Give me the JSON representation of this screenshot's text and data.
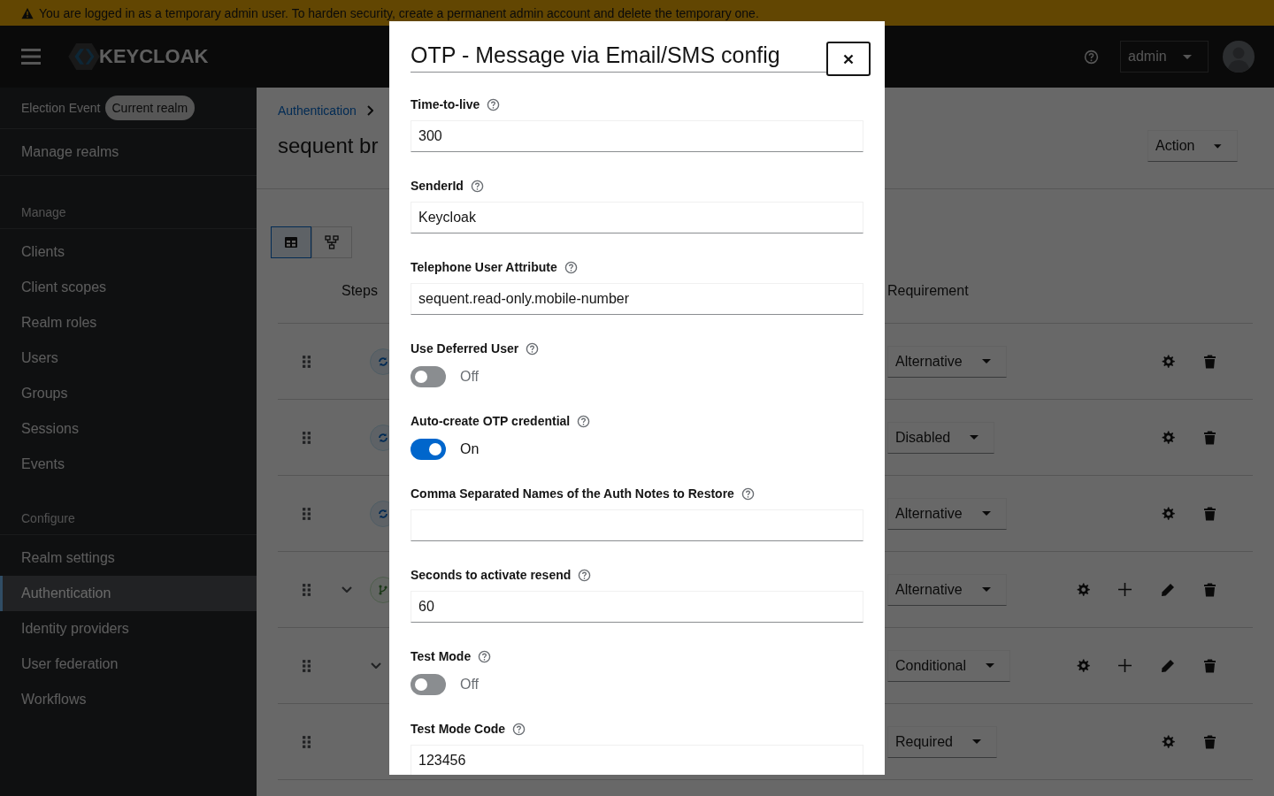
{
  "banner": {
    "text": "You are logged in as a temporary admin user. To harden security, create a permanent admin account and delete the temporary one."
  },
  "header": {
    "logo_text": "KEYCLOAK",
    "user_menu": "admin"
  },
  "sidebar": {
    "realm_label": "Election Event",
    "realm_badge": "Current realm",
    "manage_realms": "Manage realms",
    "sections": [
      {
        "title": "Manage",
        "items": [
          {
            "label": "Clients",
            "selected": false
          },
          {
            "label": "Client scopes",
            "selected": false
          },
          {
            "label": "Realm roles",
            "selected": false
          },
          {
            "label": "Users",
            "selected": false
          },
          {
            "label": "Groups",
            "selected": false
          },
          {
            "label": "Sessions",
            "selected": false
          },
          {
            "label": "Events",
            "selected": false
          }
        ]
      },
      {
        "title": "Configure",
        "items": [
          {
            "label": "Realm settings",
            "selected": false
          },
          {
            "label": "Authentication",
            "selected": true
          },
          {
            "label": "Identity providers",
            "selected": false
          },
          {
            "label": "User federation",
            "selected": false
          },
          {
            "label": "Workflows",
            "selected": false
          }
        ]
      }
    ]
  },
  "main": {
    "breadcrumb": [
      "Authentication"
    ],
    "title": "sequent br",
    "action": "Action",
    "view_toggle": [
      {
        "kind": "table",
        "selected": true
      },
      {
        "kind": "diagram",
        "selected": false
      }
    ],
    "table": {
      "columns": [
        "Steps",
        "Requirement"
      ],
      "rows": [
        {
          "kind": "execution",
          "requirement": "Alternative"
        },
        {
          "kind": "execution",
          "requirement": "Disabled"
        },
        {
          "kind": "execution",
          "requirement": "Alternative"
        },
        {
          "kind": "flow",
          "requirement": "Alternative",
          "expanded": true,
          "children": [
            {
              "kind": "flow",
              "requirement": "Conditional",
              "expanded": true,
              "children": [
                {
                  "kind": "execution",
                  "requirement": "Required"
                }
              ]
            }
          ]
        }
      ]
    }
  },
  "modal": {
    "title": "OTP - Message via Email/SMS config",
    "fields": [
      {
        "kind": "text",
        "label": "Time-to-live",
        "value": "300"
      },
      {
        "kind": "text",
        "label": "SenderId",
        "value": "Keycloak"
      },
      {
        "kind": "text",
        "label": "Telephone User Attribute",
        "value": "sequent.read-only.mobile-number"
      },
      {
        "kind": "toggle",
        "label": "Use Deferred User",
        "on": false,
        "state_label": "Off"
      },
      {
        "kind": "toggle",
        "label": "Auto-create OTP credential",
        "on": true,
        "state_label": "On"
      },
      {
        "kind": "text",
        "label": "Comma Separated Names of the Auth Notes to Restore"
      },
      {
        "kind": "text",
        "label": "Seconds to activate resend",
        "value": "60"
      },
      {
        "kind": "toggle",
        "label": "Test Mode",
        "on": false,
        "state_label": "Off"
      },
      {
        "kind": "text",
        "label": "Test Mode Code",
        "value": "123456"
      }
    ]
  }
}
